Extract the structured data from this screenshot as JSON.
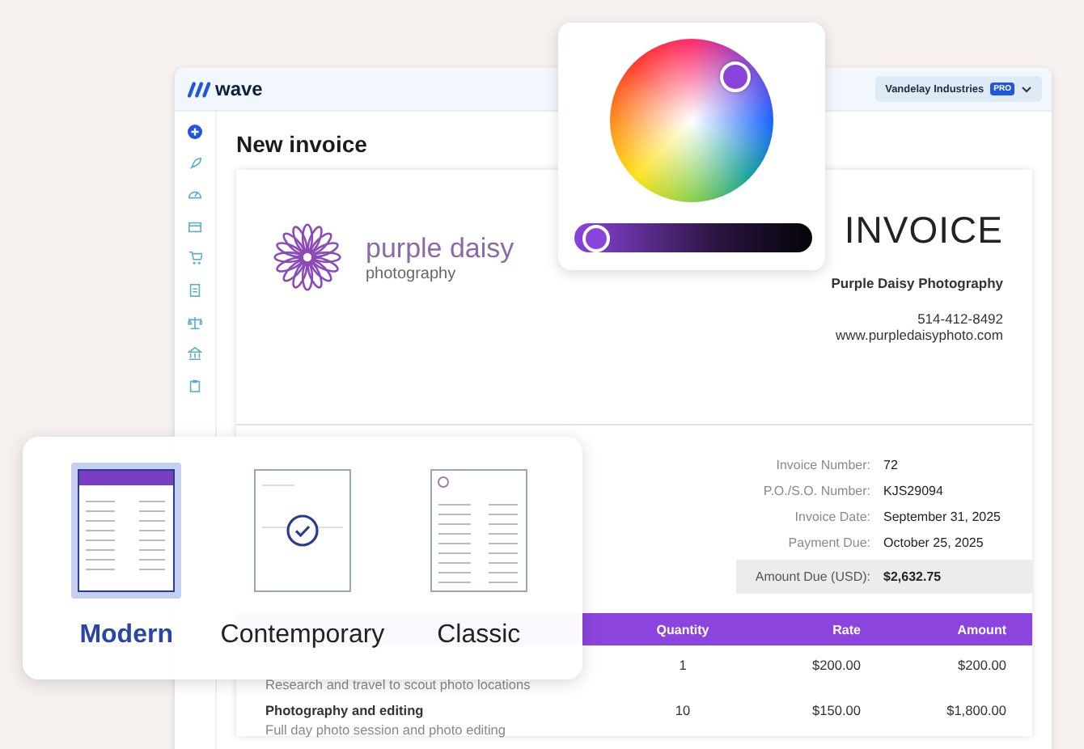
{
  "app": {
    "logo": "wave",
    "business": "Vandelay Industries",
    "plan_badge": "PRO"
  },
  "page": {
    "title": "New invoice"
  },
  "invoice": {
    "brand_name": "purple daisy",
    "brand_tagline": "photography",
    "heading": "INVOICE",
    "company": "Purple Daisy Photography",
    "phone": "514-412-8492",
    "website": "www.purpledaisyphoto.com",
    "details": [
      {
        "label": "Invoice Number:",
        "value": "72"
      },
      {
        "label": "P.O./S.O. Number:",
        "value": "KJS29094"
      },
      {
        "label": "Invoice Date:",
        "value": "September 31, 2025"
      },
      {
        "label": "Payment Due:",
        "value": "October 25, 2025"
      }
    ],
    "amount_due": {
      "label": "Amount Due (USD):",
      "value": "$2,632.75"
    },
    "table": {
      "columns": [
        "Quantity",
        "Rate",
        "Amount"
      ],
      "rows": [
        {
          "description": "Research and travel to scout photo locations",
          "quantity": "1",
          "rate": "$200.00",
          "amount": "$200.00"
        },
        {
          "item": "Photography and editing",
          "description": "Full day photo session and photo editing",
          "quantity": "10",
          "rate": "$150.00",
          "amount": "$1,800.00"
        }
      ]
    }
  },
  "color_picker": {
    "brightness": {
      "level": 0.03
    }
  },
  "templates": [
    {
      "kind": "modern",
      "label": "Modern",
      "selected": true,
      "checked": false
    },
    {
      "kind": "contemporary",
      "label": "Contemporary",
      "selected": false,
      "checked": true
    },
    {
      "kind": "classic",
      "label": "Classic",
      "selected": false,
      "checked": false
    }
  ]
}
